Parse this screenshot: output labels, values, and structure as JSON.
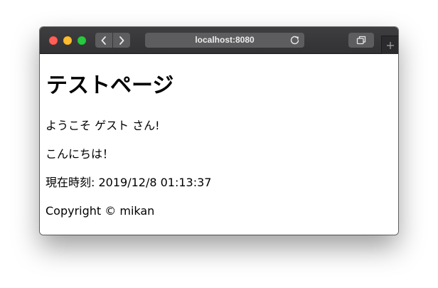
{
  "browser": {
    "address": "localhost:8080",
    "icons": {
      "back": "chevron-left-icon",
      "forward": "chevron-right-icon",
      "reload": "reload-icon",
      "tabs": "tab-overview-icon",
      "new_tab": "plus-icon"
    },
    "colors": {
      "titlebar": "#3a3a3c",
      "close": "#fe5f57",
      "minimize": "#febc2e",
      "maximize": "#28c840"
    }
  },
  "page": {
    "heading": "テストページ",
    "welcome": "ようこそ ゲスト さん!",
    "greeting": "こんにちは！",
    "current_time": "現在時刻: 2019/12/8 01:13:37",
    "copyright": "Copyright © mikan"
  }
}
